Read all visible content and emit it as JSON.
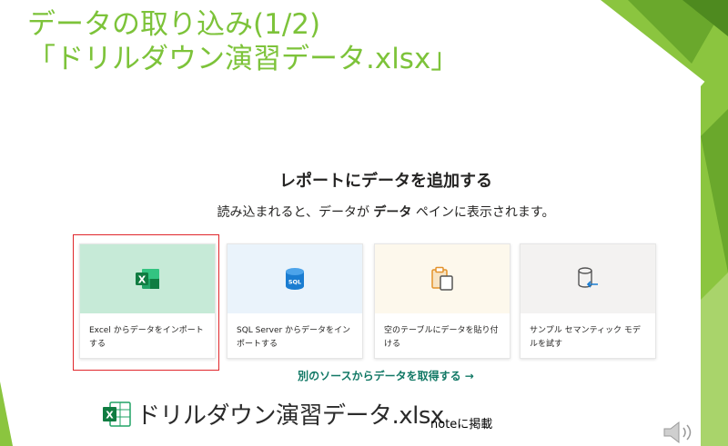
{
  "slide": {
    "title_line1": "データの取り込み(1/2)",
    "title_line2": "「ドリルダウン演習データ.xlsx」",
    "accent_color": "#7dc33a"
  },
  "dialog": {
    "heading": "レポートにデータを追加する",
    "sub_before": "読み込まれると、データが",
    "sub_bold": "データ",
    "sub_after": "ペインに表示されます。",
    "cards": [
      {
        "label": "Excel からデータをインポートする",
        "icon": "excel-icon"
      },
      {
        "label": "SQL Server からデータをインポートする",
        "icon": "sql-database-icon",
        "icon_text": "SQL"
      },
      {
        "label": "空のテーブルにデータを貼り付ける",
        "icon": "paste-table-icon"
      },
      {
        "label": "サンプル セマンティック モデルを試す",
        "icon": "sample-model-icon"
      }
    ],
    "more_link": "別のソースからデータを取得する →"
  },
  "file": {
    "icon": "excel-file-icon",
    "name": "ドリルダウン演習データ.xlsx"
  },
  "note": "noteに掲載",
  "speaker_icon": "speaker-icon"
}
